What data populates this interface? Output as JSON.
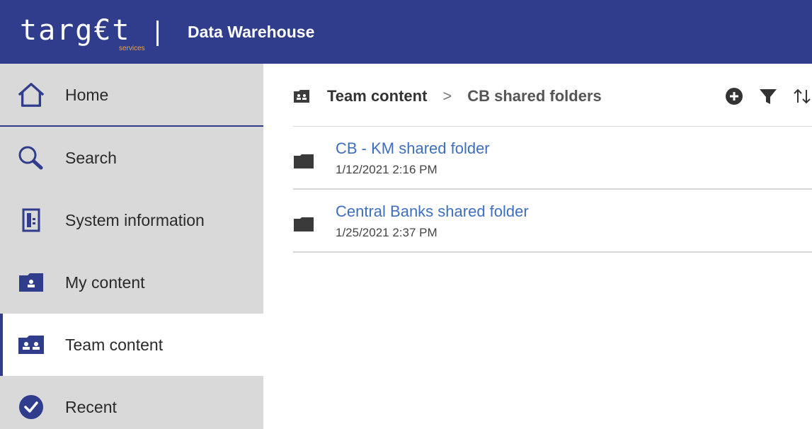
{
  "header": {
    "brand_word": "targ€t",
    "brand_sub": "services",
    "title": "Data Warehouse",
    "bg_color": "#2f3d8c",
    "accent_color": "#f2a43a"
  },
  "sidebar": {
    "items": [
      {
        "label": "Home",
        "icon": "home-icon",
        "active": false
      },
      {
        "label": "Search",
        "icon": "search-icon",
        "active": false
      },
      {
        "label": "System information",
        "icon": "system-information-icon",
        "active": false
      },
      {
        "label": "My content",
        "icon": "my-content-folder-icon",
        "active": false
      },
      {
        "label": "Team content",
        "icon": "team-content-folder-icon",
        "active": true
      },
      {
        "label": "Recent",
        "icon": "recent-check-icon",
        "active": false
      }
    ]
  },
  "breadcrumb": {
    "root": "Team content",
    "separator": ">",
    "current": "CB shared folders"
  },
  "toolbar": {
    "icons": [
      "add-icon",
      "filter-icon",
      "sort-icon"
    ]
  },
  "folders": [
    {
      "name": "CB - KM shared folder",
      "date": "1/12/2021 2:16 PM"
    },
    {
      "name": "Central Banks shared folder",
      "date": "1/25/2021 2:37 PM"
    }
  ],
  "colors": {
    "link": "#3e6fbe",
    "sidebar_bg": "#d9d9d9",
    "icon_dark": "#2f3d8c"
  }
}
